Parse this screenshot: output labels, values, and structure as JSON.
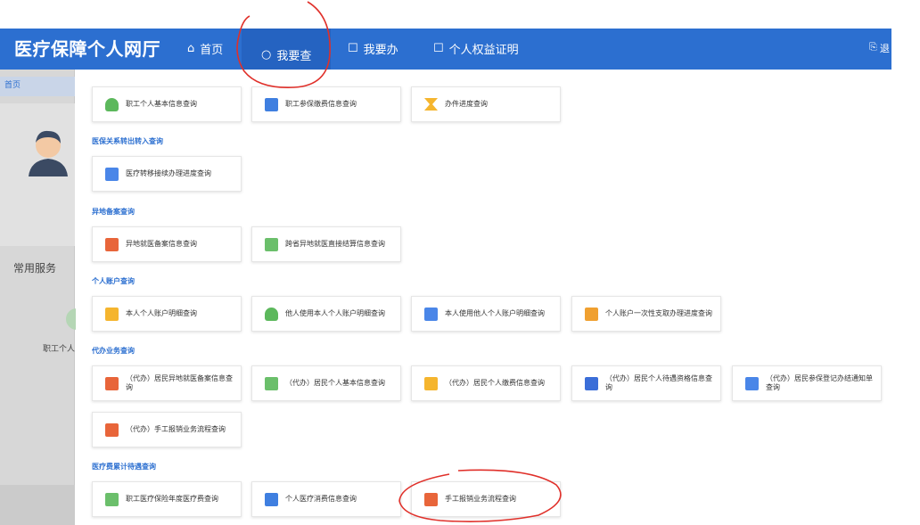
{
  "header": {
    "brand": "医疗保障个人网厅",
    "nav": [
      {
        "icon": "home-icon",
        "glyph": "⌂",
        "label": "首页"
      },
      {
        "icon": "search-icon",
        "glyph": "○",
        "label": "我要查"
      },
      {
        "icon": "task-icon",
        "glyph": "☐",
        "label": "我要办"
      },
      {
        "icon": "certificate-icon",
        "glyph": "☐",
        "label": "个人权益证明"
      }
    ],
    "logout_label": "退"
  },
  "sidebar": {
    "breadcrumb": "首页",
    "common_services_title": "常用服务",
    "service_label": "职工个人"
  },
  "sections": {
    "basic": {
      "cards": [
        {
          "label": "职工个人基本信息查询",
          "icon": "user-info-icon"
        },
        {
          "label": "职工参保缴费信息查询",
          "icon": "payment-card-icon"
        },
        {
          "label": "办件进度查询",
          "icon": "hourglass-icon"
        }
      ]
    },
    "transfer": {
      "title": "医保关系转出转入查询",
      "cards": [
        {
          "label": "医疗转移接续办理进度查询",
          "icon": "transfer-card-icon"
        }
      ]
    },
    "remote": {
      "title": "异地备案查询",
      "cards": [
        {
          "label": "异地就医备案信息查询",
          "icon": "remote-record-icon"
        },
        {
          "label": "跨省异地就医直接结算信息查询",
          "icon": "settlement-icon"
        }
      ]
    },
    "account": {
      "title": "个人账户查询",
      "cards": [
        {
          "label": "本人个人账户明细查询",
          "icon": "account-user-icon"
        },
        {
          "label": "他人使用本人个人账户明细查询",
          "icon": "account-others-icon"
        },
        {
          "label": "本人使用他人个人账户明细查询",
          "icon": "account-use-others-icon"
        },
        {
          "label": "个人账户一次性支取办理进度查询",
          "icon": "withdraw-icon"
        }
      ]
    },
    "agent": {
      "title": "代办业务查询",
      "cards": [
        {
          "label": "（代办）居民异地就医备案信息查询",
          "icon": "agent-remote-icon"
        },
        {
          "label": "（代办）居民个人基本信息查询",
          "icon": "agent-basic-icon"
        },
        {
          "label": "（代办）居民个人缴费信息查询",
          "icon": "agent-payment-icon"
        },
        {
          "label": "（代办）居民个人待遇资格信息查询",
          "icon": "agent-eligibility-icon"
        },
        {
          "label": "（代办）居民参保登记办结通知单查询",
          "icon": "agent-notice-icon"
        },
        {
          "label": "（代办）手工报销业务流程查询",
          "icon": "agent-reimburse-icon"
        }
      ]
    },
    "medical": {
      "title": "医疗费累计待遇查询",
      "cards": [
        {
          "label": "职工医疗保险年度医疗费查询",
          "icon": "annual-cost-icon"
        },
        {
          "label": "个人医疗消费信息查询",
          "icon": "consumption-icon"
        },
        {
          "label": "手工报销业务流程查询",
          "icon": "reimburse-icon"
        }
      ]
    }
  },
  "colors": {
    "header": "#2c6fd0",
    "section_title": "#2c6fd0",
    "annotation": "#e0302a"
  }
}
